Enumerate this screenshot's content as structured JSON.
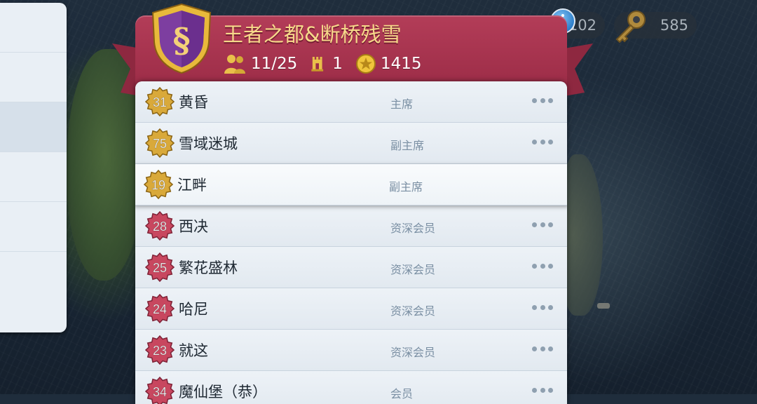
{
  "currency": {
    "first_value": "102",
    "second_value": "585"
  },
  "alliance": {
    "name": "王者之都&断桥残雪",
    "members": "11/25",
    "rank": "1",
    "points": "1415",
    "emblem_icon": "section-sign-shield-icon"
  },
  "members": [
    {
      "level": "31",
      "name": "黄昏",
      "role": "主席",
      "badge": "gold",
      "more": true
    },
    {
      "level": "75",
      "name": "雪域迷城",
      "role": "副主席",
      "badge": "gold",
      "more": true
    },
    {
      "level": "19",
      "name": "江畔",
      "role": "副主席",
      "badge": "gold",
      "more": false
    },
    {
      "level": "28",
      "name": "西决",
      "role": "资深会员",
      "badge": "red",
      "more": true
    },
    {
      "level": "25",
      "name": "繁花盛林",
      "role": "资深会员",
      "badge": "red",
      "more": true
    },
    {
      "level": "24",
      "name": "哈尼",
      "role": "资深会员",
      "badge": "red",
      "more": true
    },
    {
      "level": "23",
      "name": "就这",
      "role": "资深会员",
      "badge": "red",
      "more": true
    },
    {
      "level": "34",
      "name": "魔仙堡（恭）",
      "role": "会员",
      "badge": "red",
      "more": true
    }
  ],
  "colors": {
    "banner": "#a8354f",
    "title_gold": "#f6d98a",
    "badge_gold": "#d9a93a",
    "badge_red": "#c8475f"
  }
}
